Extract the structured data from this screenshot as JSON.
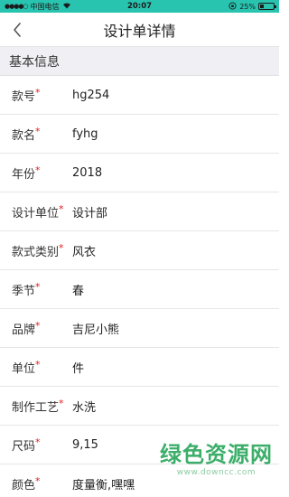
{
  "status": {
    "carrier": "中国电信",
    "time": "20:07",
    "battery_text": "25%",
    "battery_level": 0.25
  },
  "nav": {
    "title": "设计单详情"
  },
  "section": {
    "title": "基本信息"
  },
  "fields": [
    {
      "label": "款号",
      "value": "hg254"
    },
    {
      "label": "款名",
      "value": "fyhg"
    },
    {
      "label": "年份",
      "value": "2018"
    },
    {
      "label": "设计单位",
      "value": "设计部"
    },
    {
      "label": "款式类别",
      "value": "风衣"
    },
    {
      "label": "季节",
      "value": "春"
    },
    {
      "label": "品牌",
      "value": "吉尼小熊"
    },
    {
      "label": "单位",
      "value": "件"
    },
    {
      "label": "制作工艺",
      "value": "水洗"
    },
    {
      "label": "尺码",
      "value": "9,15"
    },
    {
      "label": "颜色",
      "value": "度量衡,嘿嘿"
    }
  ],
  "required_mark": "*",
  "watermark": {
    "main": "绿色资源网",
    "sub": "www.downcc.com"
  }
}
